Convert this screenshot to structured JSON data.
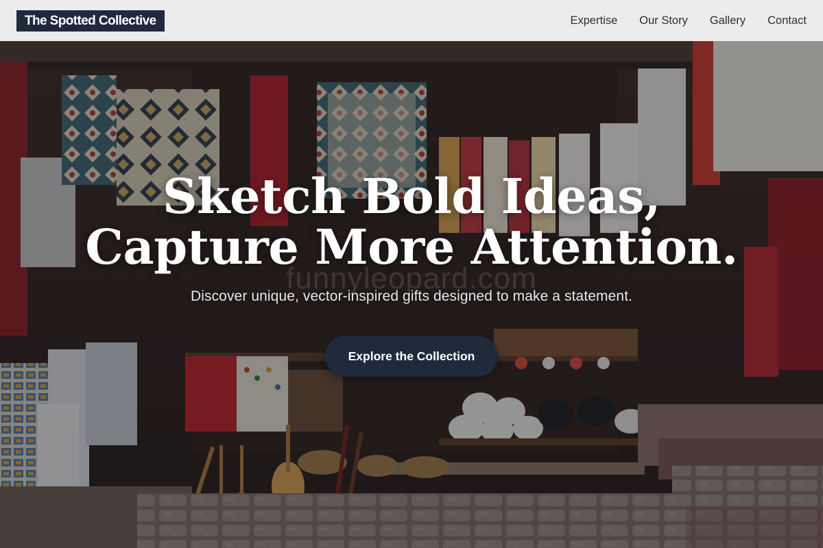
{
  "header": {
    "logo": "The Spotted Collective",
    "nav": [
      {
        "label": "Expertise"
      },
      {
        "label": "Our Story"
      },
      {
        "label": "Gallery"
      },
      {
        "label": "Contact"
      }
    ]
  },
  "hero": {
    "headline_line1": "Sketch Bold Ideas,",
    "headline_line2": "Capture More Attention.",
    "subheadline": "Discover unique, vector-inspired gifts designed to make a statement.",
    "cta_label": "Explore the Collection",
    "watermark": "funnyleopard.com",
    "background_image": "market-stall-with-textiles-and-souvenirs"
  },
  "colors": {
    "brand_navy": "#1f2a3d",
    "header_bg": "#f3f3f4",
    "nav_text": "#2b2f38",
    "hero_text": "#ffffff"
  }
}
